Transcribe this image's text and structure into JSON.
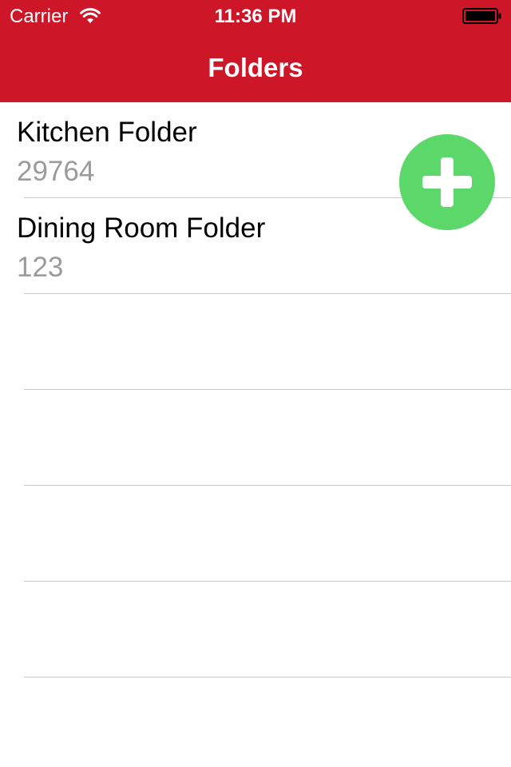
{
  "status_bar": {
    "carrier": "Carrier",
    "time": "11:36 PM",
    "wifi_icon": "wifi-icon",
    "battery_icon": "battery-icon"
  },
  "nav": {
    "title": "Folders"
  },
  "folders": [
    {
      "name": "Kitchen Folder",
      "count": "29764"
    },
    {
      "name": "Dining Room Folder",
      "count": "123"
    }
  ],
  "add_button": {
    "icon": "plus-icon"
  },
  "colors": {
    "header": "#cd1628",
    "add_button": "#5bd869",
    "subtitle": "#9b9b9b",
    "separator": "#c8c7cc"
  }
}
